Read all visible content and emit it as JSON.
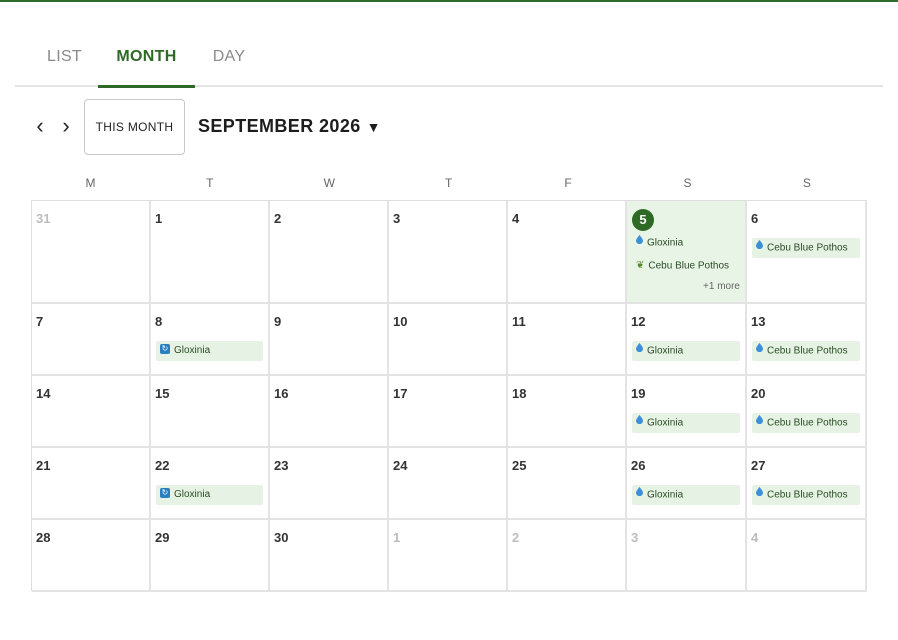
{
  "tabs": [
    {
      "label": "LIST"
    },
    {
      "label": "MONTH"
    },
    {
      "label": "DAY"
    }
  ],
  "nav": {
    "prev_icon": "‹",
    "next_icon": "›",
    "this_month_label": "THIS MONTH",
    "month_title": "SEPTEMBER 2026",
    "caret": "▼"
  },
  "weekdays": [
    "M",
    "T",
    "W",
    "T",
    "F",
    "S",
    "S"
  ],
  "colors": {
    "accent": "#2e6a25",
    "event_bg": "#e6f3e4",
    "today_bg": "#e8f4e6"
  },
  "weeks": [
    [
      {
        "day": "31",
        "other": true,
        "events": []
      },
      {
        "day": "1",
        "events": []
      },
      {
        "day": "2",
        "events": []
      },
      {
        "day": "3",
        "events": []
      },
      {
        "day": "4",
        "events": []
      },
      {
        "day": "5",
        "today": true,
        "events": [
          {
            "icon": "water-drop-icon",
            "label": "Gloxinia",
            "plain": true
          },
          {
            "icon": "fertilize-icon",
            "label": "Cebu Blue Pothos",
            "plain": true
          }
        ],
        "more": "+1 more"
      },
      {
        "day": "6",
        "events": [
          {
            "icon": "water-drop-icon",
            "label": "Cebu Blue Pothos"
          }
        ]
      }
    ],
    [
      {
        "day": "7",
        "events": []
      },
      {
        "day": "8",
        "events": [
          {
            "icon": "repot-icon",
            "label": "Gloxinia"
          }
        ]
      },
      {
        "day": "9",
        "events": []
      },
      {
        "day": "10",
        "events": []
      },
      {
        "day": "11",
        "events": []
      },
      {
        "day": "12",
        "events": [
          {
            "icon": "water-drop-icon",
            "label": "Gloxinia"
          }
        ]
      },
      {
        "day": "13",
        "events": [
          {
            "icon": "water-drop-icon",
            "label": "Cebu Blue Pothos"
          }
        ]
      }
    ],
    [
      {
        "day": "14",
        "events": []
      },
      {
        "day": "15",
        "events": []
      },
      {
        "day": "16",
        "events": []
      },
      {
        "day": "17",
        "events": []
      },
      {
        "day": "18",
        "events": []
      },
      {
        "day": "19",
        "events": [
          {
            "icon": "water-drop-icon",
            "label": "Gloxinia"
          }
        ]
      },
      {
        "day": "20",
        "events": [
          {
            "icon": "water-drop-icon",
            "label": "Cebu Blue Pothos"
          }
        ]
      }
    ],
    [
      {
        "day": "21",
        "events": []
      },
      {
        "day": "22",
        "events": [
          {
            "icon": "repot-icon",
            "label": "Gloxinia"
          }
        ]
      },
      {
        "day": "23",
        "events": []
      },
      {
        "day": "24",
        "events": []
      },
      {
        "day": "25",
        "events": []
      },
      {
        "day": "26",
        "events": [
          {
            "icon": "water-drop-icon",
            "label": "Gloxinia"
          }
        ]
      },
      {
        "day": "27",
        "events": [
          {
            "icon": "water-drop-icon",
            "label": "Cebu Blue Pothos"
          }
        ]
      }
    ],
    [
      {
        "day": "28",
        "events": []
      },
      {
        "day": "29",
        "events": []
      },
      {
        "day": "30",
        "events": []
      },
      {
        "day": "1",
        "other": true,
        "events": []
      },
      {
        "day": "2",
        "other": true,
        "events": []
      },
      {
        "day": "3",
        "other": true,
        "events": []
      },
      {
        "day": "4",
        "other": true,
        "events": []
      }
    ]
  ]
}
